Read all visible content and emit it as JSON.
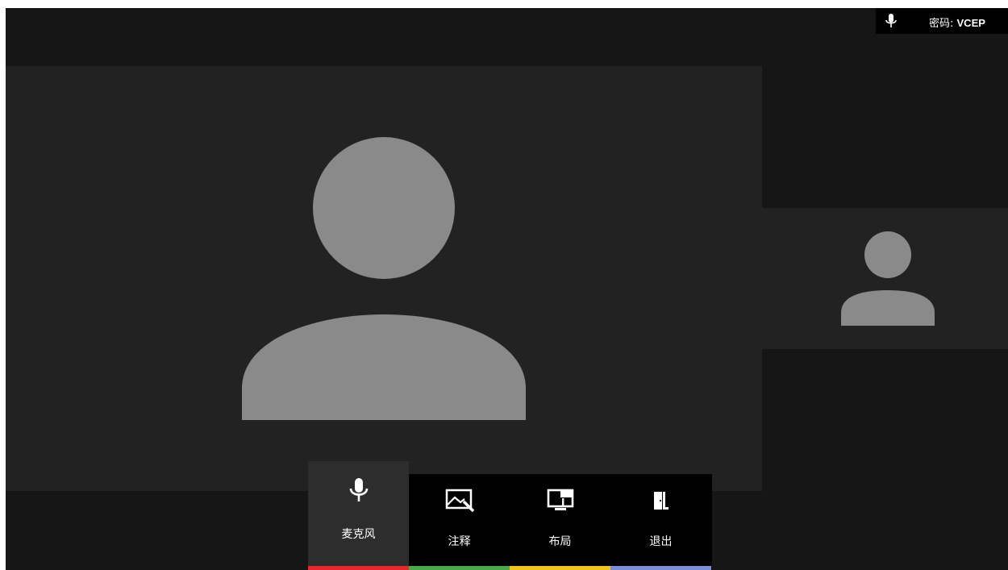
{
  "status": {
    "password_label": "密码: ",
    "password_value": "VCEP",
    "mic_icon": "microphone-icon"
  },
  "toolbar": {
    "items": [
      {
        "label": "麦克风",
        "icon": "microphone-icon",
        "color": "#e8262b",
        "active": true
      },
      {
        "label": "注释",
        "icon": "annotate-icon",
        "color": "#4aa94a",
        "active": false
      },
      {
        "label": "布局",
        "icon": "layout-icon",
        "color": "#f2c51c",
        "active": false
      },
      {
        "label": "退出",
        "icon": "exit-door-icon",
        "color": "#7b8fd8",
        "active": false
      }
    ]
  },
  "colors": {
    "background": "#161616",
    "video_tile": "#222222",
    "avatar": "#8a8a8a"
  }
}
